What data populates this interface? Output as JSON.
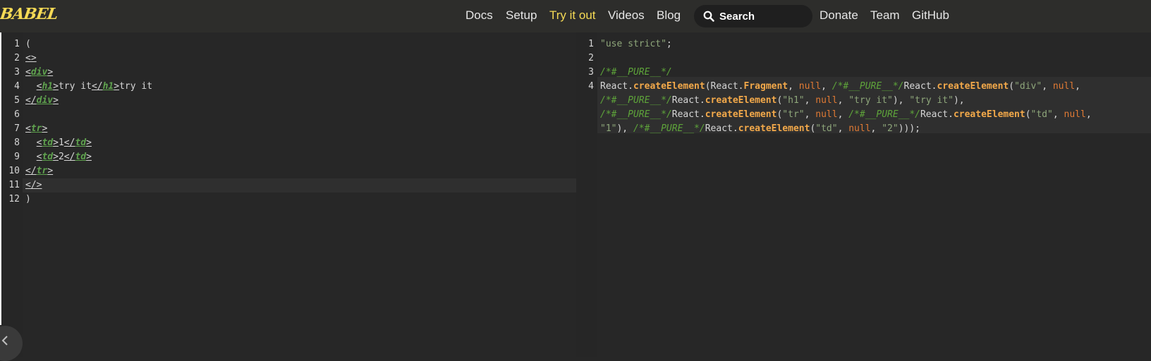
{
  "header": {
    "logo": "BABEL",
    "nav": [
      "Docs",
      "Setup",
      "Try it out",
      "Videos",
      "Blog"
    ],
    "search_placeholder": "Search",
    "nav_right": [
      "Donate",
      "Team",
      "GitHub"
    ]
  },
  "input_editor": {
    "line_numbers": [
      "1",
      "2",
      "3",
      "4",
      "5",
      "6",
      "7",
      "8",
      "9",
      "10",
      "11",
      "12"
    ]
  },
  "output_editor": {
    "line_numbers": [
      "1",
      "2",
      "3",
      "4"
    ]
  },
  "colors": {
    "accent": "#f5da55",
    "background": "#272727",
    "tag": "#5fa24e",
    "string": "#8ea67a",
    "function": "#f3a94a",
    "keyword": "#e07a34"
  },
  "icons": [
    "search-icon",
    "chevron-left-icon"
  ]
}
